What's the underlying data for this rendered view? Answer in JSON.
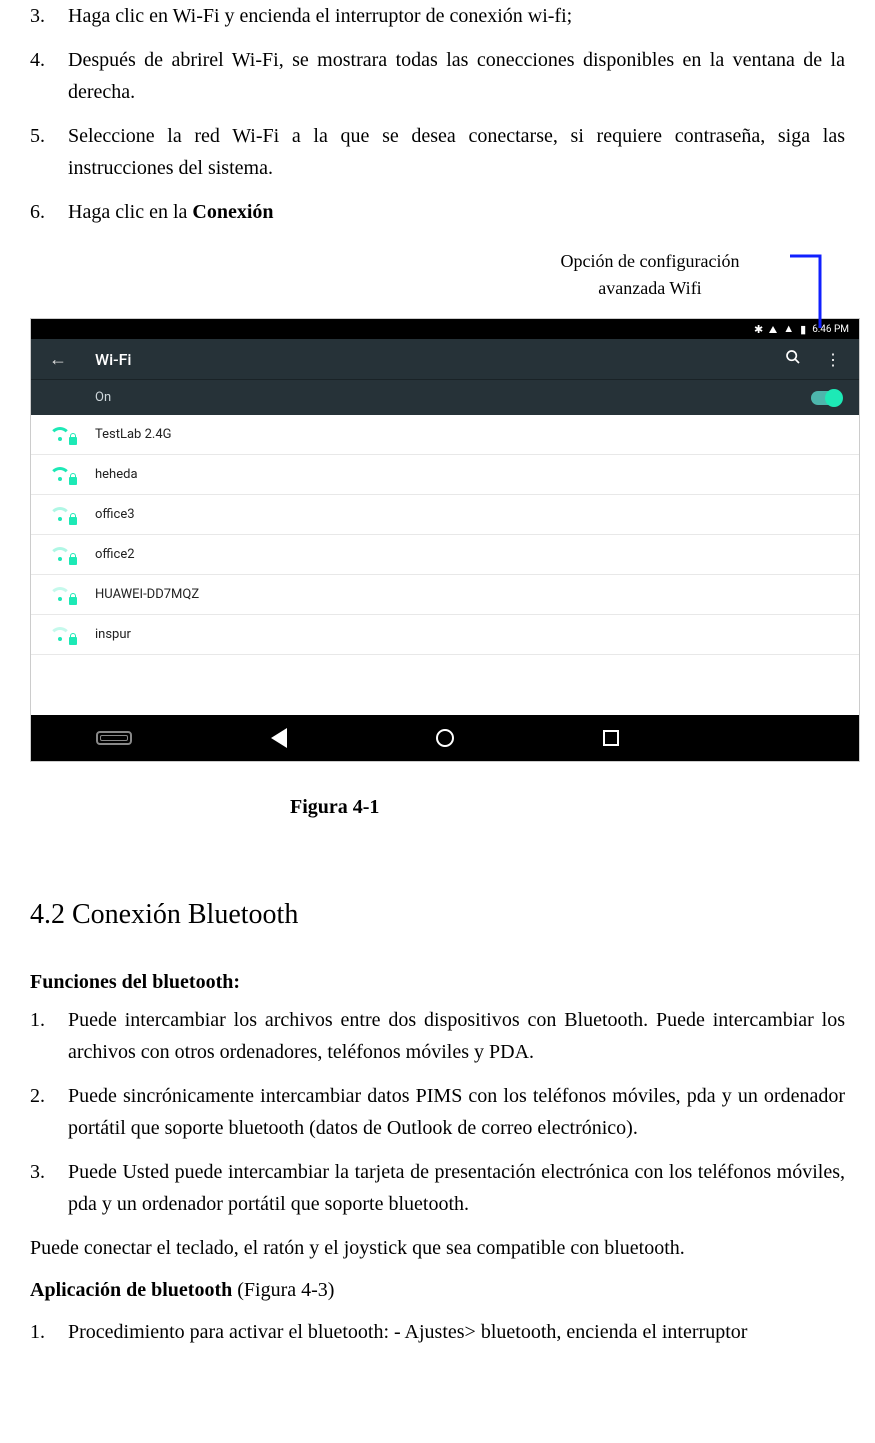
{
  "top_steps": [
    {
      "num": "3.",
      "text": "Haga clic en Wi-Fi y encienda el interruptor de conexión wi-fi;"
    },
    {
      "num": "4.",
      "text": "Después de abrirel Wi-Fi, se mostrara todas las conecciones disponibles en la ventana de la derecha."
    },
    {
      "num": "5.",
      "text": "Seleccione la red Wi-Fi a la que se desea conectarse, si requiere contraseña, siga las instrucciones del sistema."
    },
    {
      "num": "6.",
      "textPrefix": "Haga clic en la ",
      "textBold": "Conexión"
    }
  ],
  "callout": {
    "line1": "Opción de configuración",
    "line2": "avanzada Wifi"
  },
  "android": {
    "status": {
      "time": "6:46 PM"
    },
    "header": {
      "title": "Wi-Fi"
    },
    "onrow": {
      "label": "On"
    },
    "networks": [
      {
        "name": "TestLab 2.4G",
        "strength": "full"
      },
      {
        "name": "heheda",
        "strength": "full"
      },
      {
        "name": "office3",
        "strength": "med"
      },
      {
        "name": "office2",
        "strength": "med"
      },
      {
        "name": "HUAWEI-DD7MQZ",
        "strength": "low"
      },
      {
        "name": "inspur",
        "strength": "low"
      }
    ]
  },
  "figure_caption": "Figura   4-1",
  "section_title": "4.2 Conexión Bluetooth",
  "bt_heading": "Funciones del bluetooth:",
  "bt_list": [
    {
      "num": "1.",
      "text": "Puede intercambiar los archivos entre dos dispositivos con Bluetooth. Puede intercambiar los archivos con otros ordenadores, teléfonos móviles y PDA."
    },
    {
      "num": "2.",
      "text": "Puede sincrónicamente intercambiar datos PIMS con los teléfonos móviles, pda y un ordenador portátil que soporte bluetooth (datos de Outlook de correo electrónico)."
    },
    {
      "num": "3.",
      "text": "Puede Usted puede intercambiar la tarjeta de presentación electrónica con los teléfonos móviles, pda y un ordenador portátil que soporte bluetooth."
    }
  ],
  "bt_tail": "Puede conectar el teclado, el ratón y el joystick que sea compatible con bluetooth.",
  "bt_app_label_bold": "Aplicación de bluetooth",
  "bt_app_label_rest": " (Figura 4-3)",
  "bt_proc": [
    {
      "num": "1.",
      "text": "Procedimiento para activar el bluetooth: - Ajustes> bluetooth,   encienda el interruptor"
    }
  ]
}
